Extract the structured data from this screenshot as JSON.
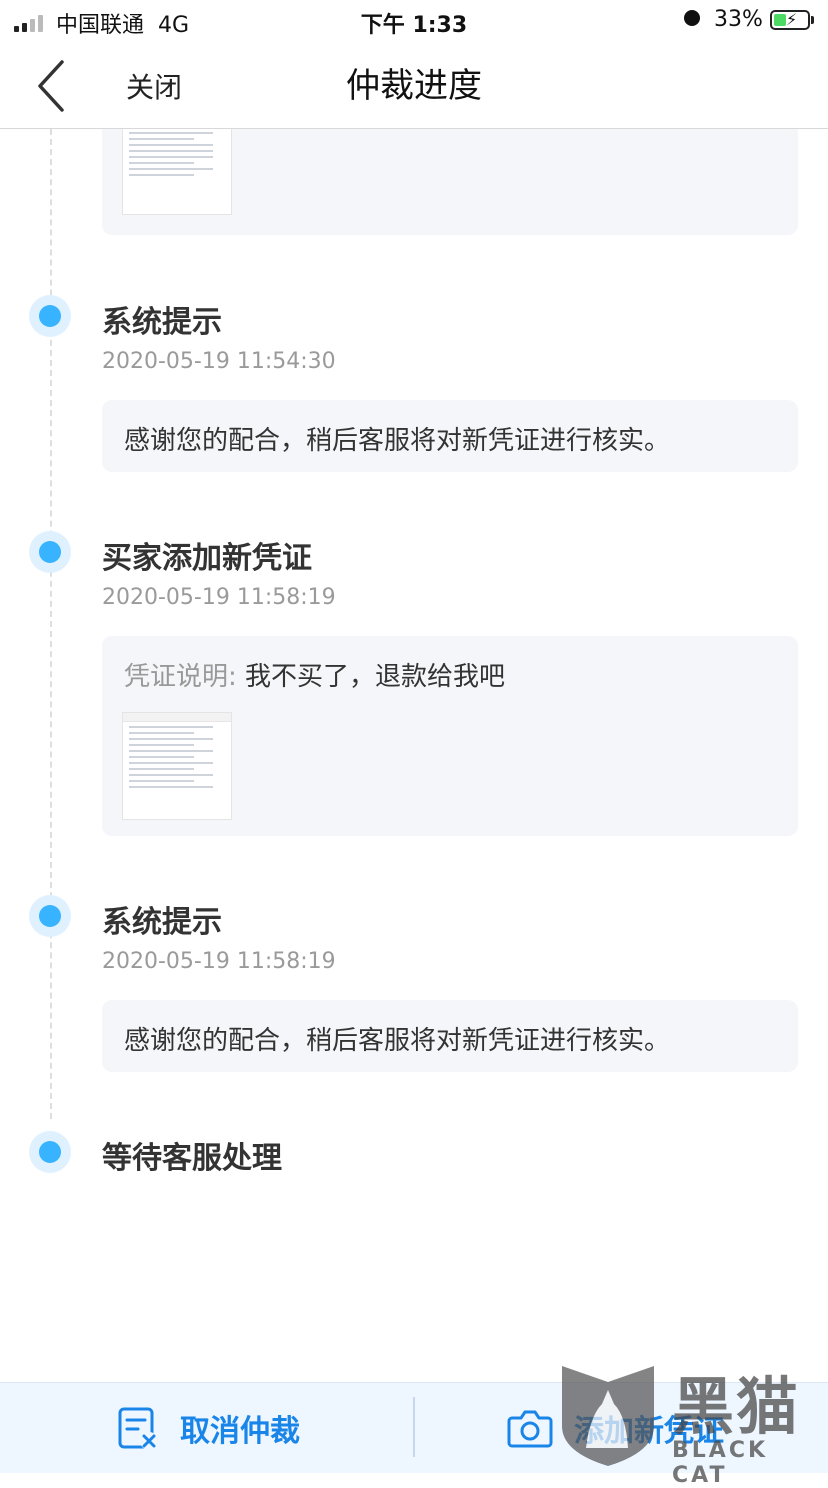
{
  "status_bar": {
    "carrier": "中国联通",
    "network": "4G",
    "time": "下午 1:33",
    "battery_percent": "33%",
    "signal_bars": 2
  },
  "nav": {
    "close_label": "关闭",
    "title": "仲裁进度",
    "back_icon": "chevron-left-icon"
  },
  "timeline": {
    "events": [
      {
        "title": "系统提示",
        "time": "2020-05-19 11:54:30",
        "message": "感谢您的配合，稍后客服将对新凭证进行核实。"
      },
      {
        "title": "买家添加新凭证",
        "time": "2020-05-19 11:58:19",
        "evidence_label": "凭证说明:",
        "evidence_text": "我不买了，退款给我吧"
      },
      {
        "title": "系统提示",
        "time": "2020-05-19 11:58:19",
        "message": "感谢您的配合，稍后客服将对新凭证进行核实。"
      },
      {
        "title": "等待客服处理"
      }
    ]
  },
  "bottom_bar": {
    "cancel_label": "取消仲裁",
    "cancel_icon": "cancel-document-icon",
    "add_label": "添加新凭证",
    "add_icon": "camera-icon"
  },
  "watermark": {
    "cn": "黑猫",
    "en": "BLACK CAT"
  },
  "colors": {
    "accent": "#38b3ff",
    "button_text": "#1a85e8",
    "card_bg": "#f5f6f9"
  }
}
